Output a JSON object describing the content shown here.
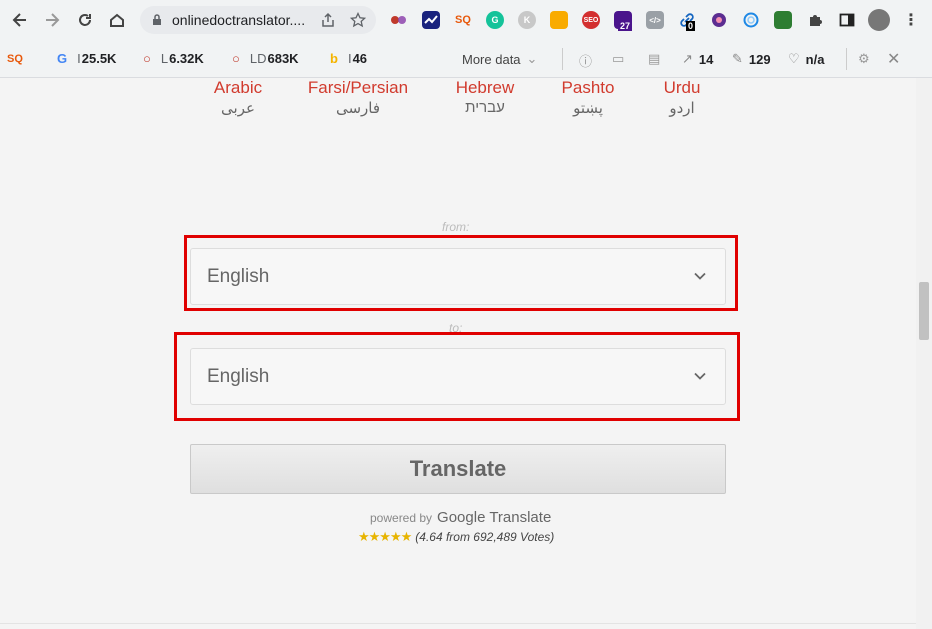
{
  "browser": {
    "url": "onlinedoctranslator....",
    "extensions": [
      "color-picker-icon",
      "trend-icon",
      "seoquake-icon",
      "grammarly-icon",
      "k-icon",
      "yellow-ext-icon",
      "seo-icon",
      "hat-icon",
      "code-icon",
      "link-icon",
      "circle-icon",
      "ring-icon",
      "green-ext-icon",
      "puzzle-icon",
      "sidebar-icon"
    ],
    "badges": {
      "hat": "27",
      "link": "0"
    }
  },
  "seo_bar": {
    "google_prefix": "I",
    "google_value": "25.5K",
    "l_prefix": "L",
    "l_value": "6.32K",
    "ld_prefix": "LD",
    "ld_value": "683K",
    "bing_prefix": "I",
    "bing_value": "46",
    "more_data": "More data",
    "external_links": "14",
    "internal_links": "129",
    "health": "n/a"
  },
  "languages": [
    {
      "name": "Arabic",
      "native": "عربى"
    },
    {
      "name": "Farsi/Persian",
      "native": "فارسی"
    },
    {
      "name": "Hebrew",
      "native": "עברית"
    },
    {
      "name": "Pashto",
      "native": "پښتو"
    },
    {
      "name": "Urdu",
      "native": "اردو"
    }
  ],
  "form": {
    "from_label": "from:",
    "from_value": "English",
    "to_label": "to:",
    "to_value": "English",
    "translate_label": "Translate"
  },
  "footer": {
    "powered_by": "powered by",
    "google_translate": "Google Translate",
    "stars": "★★★★★",
    "rating_text": "(4.64 from 692,489 Votes)"
  },
  "colors": {
    "accent_red": "#e00000",
    "language_red": "#d13b2e",
    "star_gold": "#e7b400"
  }
}
